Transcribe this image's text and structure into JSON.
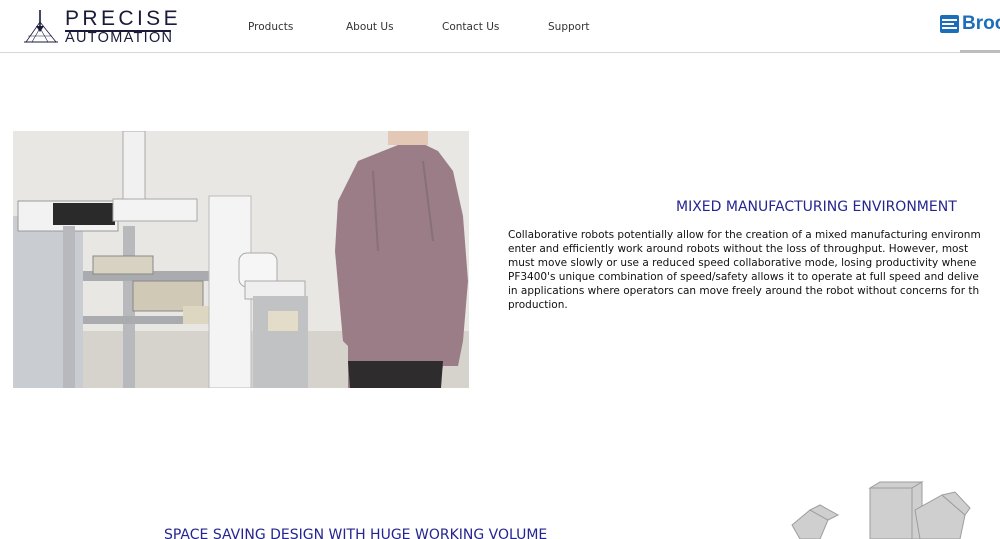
{
  "header": {
    "logo": {
      "line1": "PRECISE",
      "line2": "AUTOMATION"
    },
    "nav": [
      {
        "label": "Products"
      },
      {
        "label": "About Us"
      },
      {
        "label": "Contact Us"
      },
      {
        "label": "Support"
      }
    ],
    "partner_logo": {
      "text": "Brooks",
      "icon": "brooks-logo-icon"
    }
  },
  "section1": {
    "image": "collaborative-robot-photo",
    "title": "MIXED MANUFACTURING ENVIRONMENT",
    "body_lines": [
      "Collaborative robots potentially allow for the creation of a mixed manufacturing environm",
      "enter and efficiently work around robots without the loss of throughput. However, most",
      "must move slowly or use a reduced speed collaborative mode, losing productivity whene",
      "PF3400's unique combination of speed/safety allows it to operate at full speed and delive",
      "in applications where operators can move freely around the robot without concerns for th",
      "production."
    ]
  },
  "section2": {
    "title": "SPACE SAVING DESIGN WITH HUGE WORKING VOLUME",
    "image": "working-volume-render"
  },
  "colors": {
    "heading": "#25258f",
    "brand": "#1a1a3a",
    "partner": "#1b6fb8"
  }
}
